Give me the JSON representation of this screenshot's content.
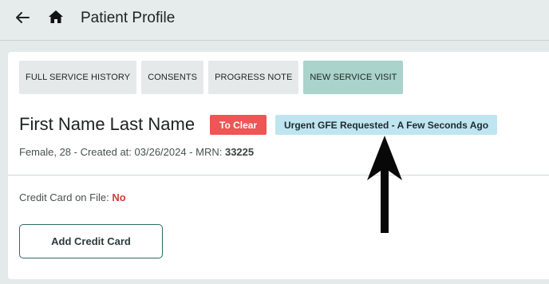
{
  "header": {
    "back_icon": "arrow-left-icon",
    "home_icon": "home-icon",
    "title": "Patient Profile"
  },
  "tabs": [
    {
      "label": "FULL SERVICE HISTORY",
      "active": false
    },
    {
      "label": "CONSENTS",
      "active": false
    },
    {
      "label": "PROGRESS NOTE",
      "active": false
    },
    {
      "label": "NEW SERVICE VISIT",
      "active": true
    }
  ],
  "patient": {
    "name": "First Name Last Name",
    "status_badge": "To Clear",
    "urgent_badge": "Urgent GFE Requested - A Few Seconds Ago",
    "details_prefix": "Female, 28 - Created at: 03/26/2024 - MRN: ",
    "mrn": "33225"
  },
  "billing": {
    "credit_card_label": "Credit Card on File: ",
    "credit_card_value": "No",
    "add_card_button": "Add Credit Card"
  },
  "colors": {
    "active_tab": "#a9d3cb",
    "clear_badge": "#ef5555",
    "urgent_badge": "#bfe6f0",
    "no_value": "#d33a3a",
    "button_border": "#2f6b66"
  },
  "annotation": {
    "icon": "up-arrow-annotation-icon"
  }
}
